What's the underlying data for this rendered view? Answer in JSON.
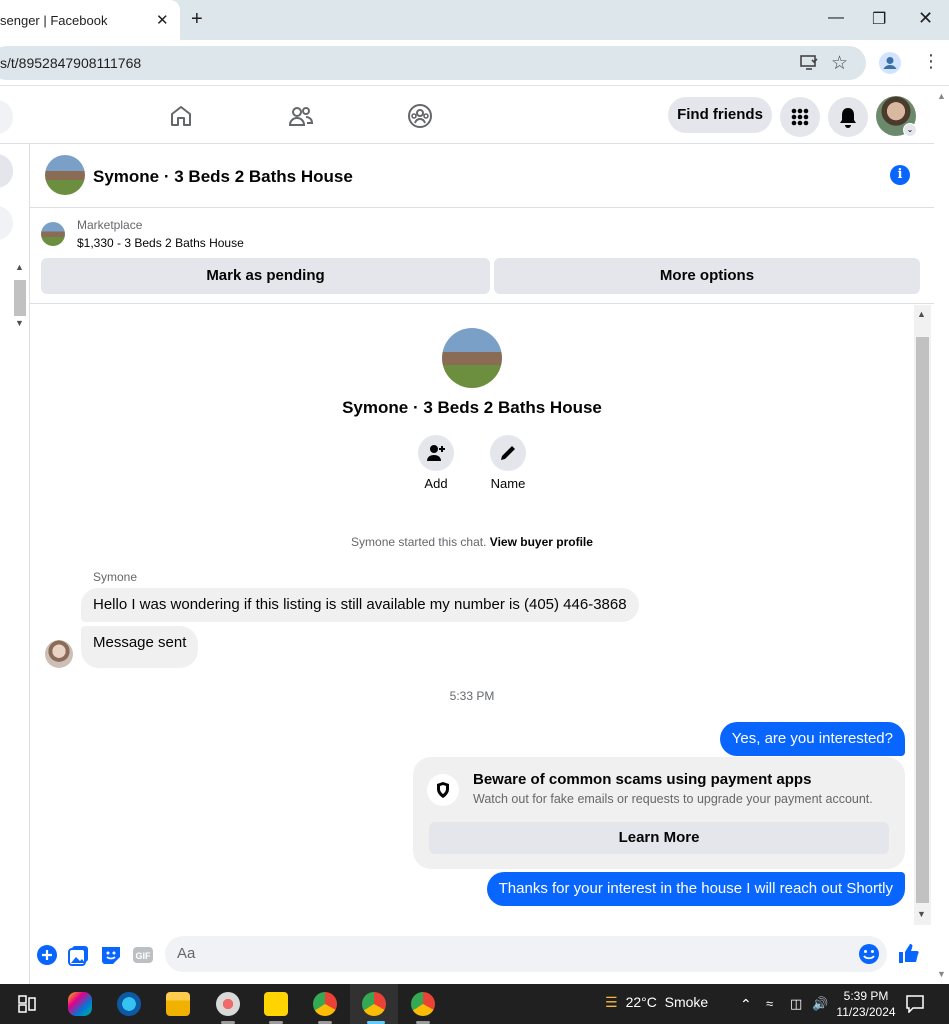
{
  "browser": {
    "tab_title": "senger | Facebook",
    "tab_close": "✕",
    "new_tab": "+",
    "url": "s/t/8952847908111768"
  },
  "fb_nav": {
    "find_friends_label": "Find friends"
  },
  "chat": {
    "title": "Symone · 3 Beds 2 Baths House",
    "info_glyph": "i",
    "listing": {
      "label": "Marketplace",
      "price_title": "$1,330 - 3 Beds 2 Baths House",
      "mark_pending_label": "Mark as pending",
      "more_options_label": "More options"
    },
    "intro": {
      "title": "Symone · 3 Beds 2 Baths House",
      "add_label": "Add",
      "name_label": "Name",
      "started_text": "Symone started this chat.",
      "view_profile_link": "View buyer profile"
    },
    "messages": {
      "sender_name": "Symone",
      "incoming": [
        "Hello I was wondering if this listing is still available my number is (405) 446-3868",
        "Message sent"
      ],
      "timestamp": "5:33 PM",
      "outgoing_1": "Yes, are you interested?",
      "scam_card": {
        "title": "Beware of common scams using payment apps",
        "subtitle": "Watch out for fake emails or requests to upgrade your payment account.",
        "button_label": "Learn More"
      },
      "outgoing_2": "Thanks for your interest in the house I will reach out Shortly"
    },
    "composer": {
      "placeholder": "Aa"
    }
  },
  "taskbar": {
    "weather_temp": "22°C",
    "weather_desc": "Smoke",
    "time": "5:39 PM",
    "date": "11/23/2024"
  },
  "colors": {
    "brand_blue": "#0866ff",
    "bubble_gray": "#f0f0f0",
    "button_gray": "#e4e6eb"
  }
}
